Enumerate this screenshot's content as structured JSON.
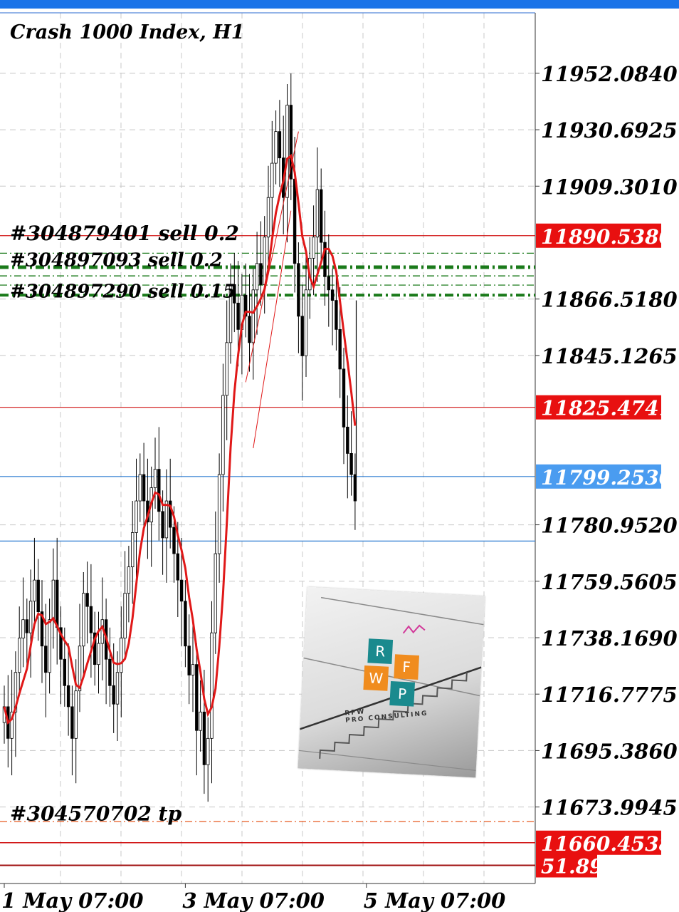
{
  "chart_title": "Crash 1000 Index, H1",
  "chart_data": {
    "type": "candlestick",
    "title": "Crash 1000 Index, H1",
    "ylim": [
      11645.0,
      11975.0
    ],
    "y_ticks": [
      "11952.0840",
      "11930.6925",
      "11909.3010",
      "11866.5180",
      "11845.1265",
      "11780.9520",
      "11759.5605",
      "11738.1690",
      "11716.7775",
      "11695.3860",
      "11673.9945"
    ],
    "x_ticks": [
      {
        "label": "1 May 07:00",
        "index": 0
      },
      {
        "label": "3 May 07:00",
        "index": 48
      },
      {
        "label": "5 May 07:00",
        "index": 96
      }
    ],
    "price_tags": [
      {
        "label": "11890.5380",
        "value": 11890.538,
        "color": "#e81010"
      },
      {
        "label": "11825.4741",
        "value": 11825.4741,
        "color": "#e81010"
      },
      {
        "label": "11799.2530",
        "value": 11799.253,
        "color": "#4a9cf0"
      },
      {
        "label": "11660.4538",
        "value": 11660.4538,
        "color": "#e81010"
      },
      {
        "label": "51.89",
        "value": 11651.89,
        "color": "#e81010"
      }
    ],
    "order_labels": [
      {
        "text": "#304879401 sell 0.2",
        "value": 11890.538
      },
      {
        "text": "#304897093 sell 0.2",
        "value": 11880.6
      },
      {
        "text": "#304897290 sell 0.15",
        "value": 11868.8
      },
      {
        "text": "#304570702 tp",
        "value": 11670.5
      }
    ],
    "close": [
      11712,
      11700,
      11710,
      11725,
      11738,
      11745,
      11740,
      11752,
      11760,
      11748,
      11735,
      11725,
      11745,
      11760,
      11742,
      11730,
      11720,
      11712,
      11700,
      11718,
      11735,
      11755,
      11750,
      11740,
      11728,
      11736,
      11745,
      11730,
      11720,
      11713,
      11725,
      11738,
      11755,
      11765,
      11778,
      11790,
      11800,
      11790,
      11782,
      11795,
      11802,
      11786,
      11776,
      11790,
      11780,
      11770,
      11760,
      11752,
      11735,
      11724,
      11728,
      11703,
      11710,
      11690,
      11700,
      11740,
      11770,
      11800,
      11830,
      11850,
      11872,
      11865,
      11855,
      11868,
      11860,
      11850,
      11870,
      11880,
      11872,
      11890,
      11905,
      11918,
      11930,
      11920,
      11905,
      11940,
      11912,
      11880,
      11860,
      11845,
      11870,
      11882,
      11890,
      11908,
      11888,
      11875,
      11870,
      11866,
      11855,
      11840,
      11818,
      11808,
      11800,
      11790
    ]
  }
}
